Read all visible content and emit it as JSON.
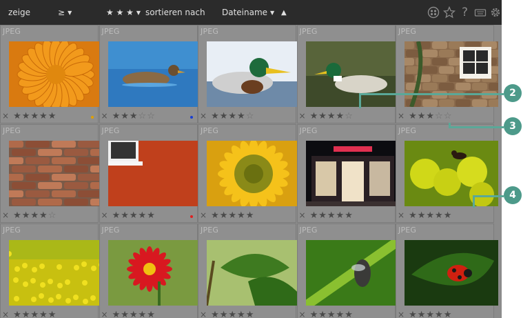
{
  "toolbar": {
    "show_label": "zeige",
    "comparator": "≥",
    "rating_filter": "★ ★ ★",
    "sort_label": "sortieren nach",
    "sort_field": "Dateiname",
    "sort_direction": "▲",
    "dropdown_glyph": "▼",
    "icons": [
      "color-labels-icon",
      "star-icon",
      "help-icon",
      "keyboard-icon",
      "gear-icon"
    ]
  },
  "grid": {
    "cells": [
      {
        "type": "JPEG",
        "stars": 5,
        "label_color": "#e0a000",
        "subject": "orange-dahlia"
      },
      {
        "type": "JPEG",
        "stars": 3,
        "label_color": "#1a3fd0",
        "subject": "duck-on-water"
      },
      {
        "type": "JPEG",
        "stars": 4,
        "label_color": "",
        "subject": "mallard-drake"
      },
      {
        "type": "JPEG",
        "stars": 4,
        "label_color": "",
        "subject": "mallard-in-pond"
      },
      {
        "type": "JPEG",
        "stars": 3,
        "label_color": "",
        "subject": "stone-wall-window"
      },
      {
        "type": "JPEG",
        "stars": 4,
        "label_color": "",
        "subject": "brick-wall"
      },
      {
        "type": "JPEG",
        "stars": 5,
        "label_color": "#e02020",
        "subject": "red-wall-window"
      },
      {
        "type": "JPEG",
        "stars": 5,
        "label_color": "",
        "subject": "sunflower"
      },
      {
        "type": "JPEG",
        "stars": 5,
        "label_color": "",
        "subject": "shop-at-night"
      },
      {
        "type": "JPEG",
        "stars": 5,
        "label_color": "",
        "subject": "ant-on-flower"
      },
      {
        "type": "JPEG",
        "stars": 5,
        "label_color": "",
        "subject": "rapeseed-field"
      },
      {
        "type": "JPEG",
        "stars": 5,
        "label_color": "",
        "subject": "red-daisy"
      },
      {
        "type": "JPEG",
        "stars": 5,
        "label_color": "",
        "subject": "green-leaves"
      },
      {
        "type": "JPEG",
        "stars": 5,
        "label_color": "",
        "subject": "fly-on-grass"
      },
      {
        "type": "JPEG",
        "stars": 5,
        "label_color": "",
        "subject": "ladybug-on-leaf"
      }
    ],
    "reject_glyph": "×",
    "star_glyph": "★",
    "empty_star_glyph": "☆"
  },
  "callouts": [
    "2",
    "3",
    "4"
  ]
}
